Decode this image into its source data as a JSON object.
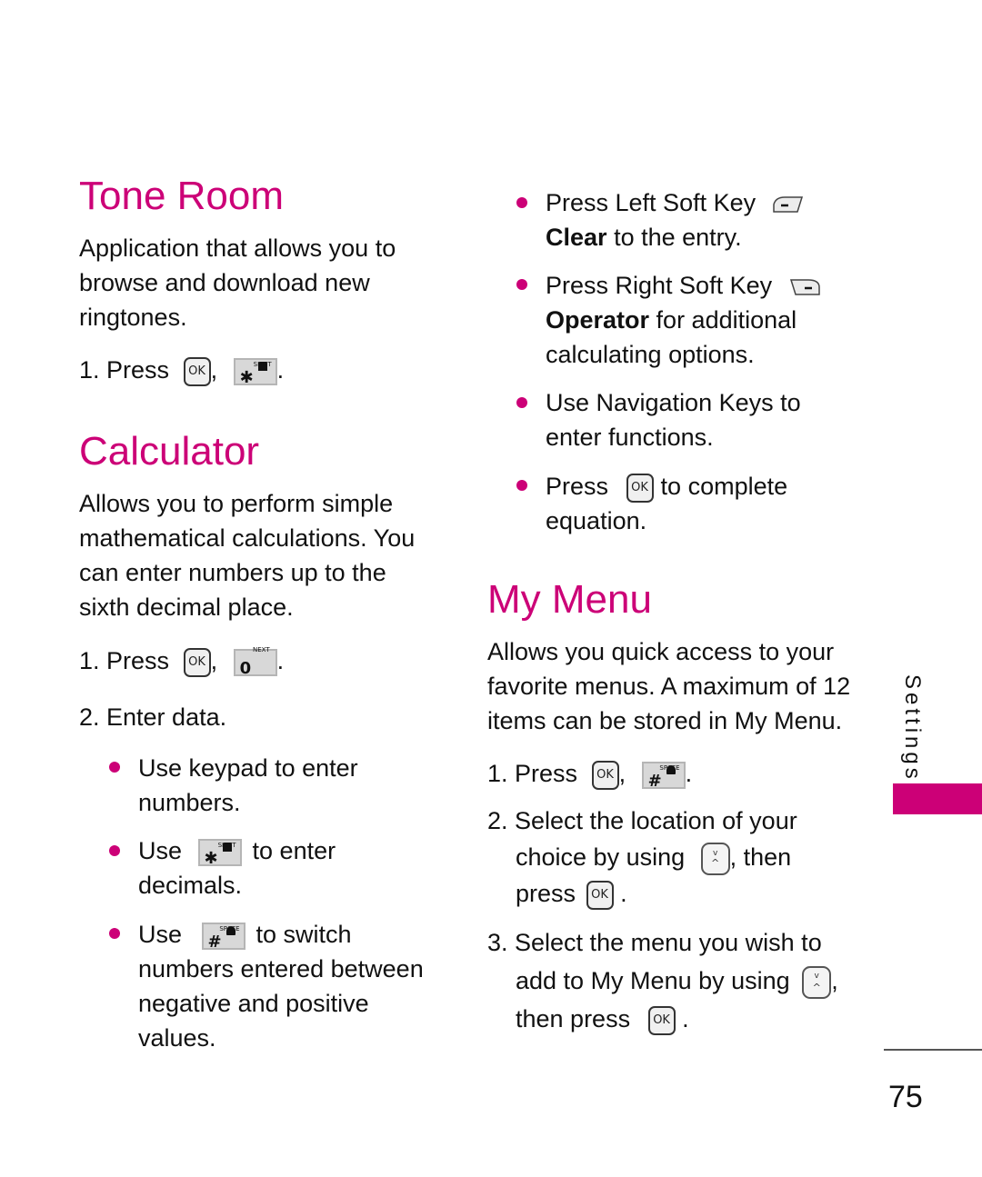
{
  "tone_room": {
    "title": "Tone Room",
    "description": [
      "Application that allows you to",
      "browse and download new",
      "ringtones."
    ],
    "step1": {
      "prefix": "1. Press",
      "sep": ",",
      "end": "."
    }
  },
  "calculator": {
    "title": "Calculator",
    "description": [
      "Allows you to perform simple",
      "mathematical calculations. You",
      "can enter numbers up to the",
      "sixth decimal place."
    ],
    "step1": {
      "prefix": "1. Press",
      "sep": ",",
      "end": "."
    },
    "step2": "2. Enter data.",
    "bullets": {
      "b1": [
        "Use keypad to enter",
        "numbers."
      ],
      "b2": {
        "pre": "Use",
        "post": "to enter",
        "line2": "decimals."
      },
      "b3": {
        "pre": "Use",
        "post": "to switch",
        "line2": "numbers entered between",
        "line3": "negative and positive",
        "line4": "values."
      },
      "b4": {
        "pre": "Press Left Soft Key",
        "bold": "Clear",
        "post": "to the entry."
      },
      "b5": {
        "pre": "Press Right Soft Key",
        "bold": "Operator",
        "post": "for additional",
        "line3": "calculating options."
      },
      "b6": [
        "Use Navigation Keys to",
        "enter functions."
      ],
      "b7": {
        "pre": "Press",
        "post": "to complete",
        "line2": "equation."
      }
    }
  },
  "my_menu": {
    "title": "My Menu",
    "description": [
      "Allows you quick access to your",
      "favorite menus. A maximum of 12",
      "items can be stored in My Menu."
    ],
    "step1": {
      "prefix": "1. Press",
      "sep": ",",
      "end": "."
    },
    "step2": {
      "line1": "2. Select the location of your",
      "line2_pre": "choice by using",
      "line2_post": ", then",
      "line3_pre": "press",
      "line3_post": "."
    },
    "step3": {
      "line1": "3. Select the menu you wish to",
      "line2_pre": "add to My Menu by using",
      "line2_post": ",",
      "line3_pre": "then press",
      "line3_post": "."
    }
  },
  "keys": {
    "ok": "OK",
    "star_main": "✱",
    "star_sub": "SHIFT",
    "zero_main": "0",
    "zero_sub": "NEXT",
    "hash_main": "#",
    "hash_sub": "SPACE",
    "nav_up": "^",
    "nav_down": "v"
  },
  "sidebar": {
    "section": "Settings"
  },
  "footer": {
    "page_number": "75"
  },
  "colors": {
    "accent": "#cc0077"
  }
}
